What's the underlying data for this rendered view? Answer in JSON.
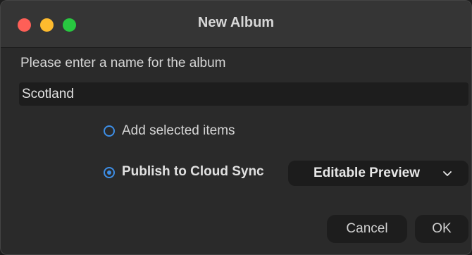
{
  "window": {
    "title": "New Album"
  },
  "form": {
    "prompt": "Please enter a name for the album",
    "album_name": "Scotland"
  },
  "options": {
    "add_selected_label": "Add selected items",
    "add_selected_checked": false,
    "publish_label": "Publish to Cloud Sync",
    "publish_checked": true,
    "quality_select_value": "Editable Preview"
  },
  "buttons": {
    "cancel": "Cancel",
    "ok": "OK"
  },
  "colors": {
    "accent": "#3d8ee6",
    "close": "#fe5f57",
    "minimize": "#febb2e",
    "maximize": "#28c840"
  }
}
